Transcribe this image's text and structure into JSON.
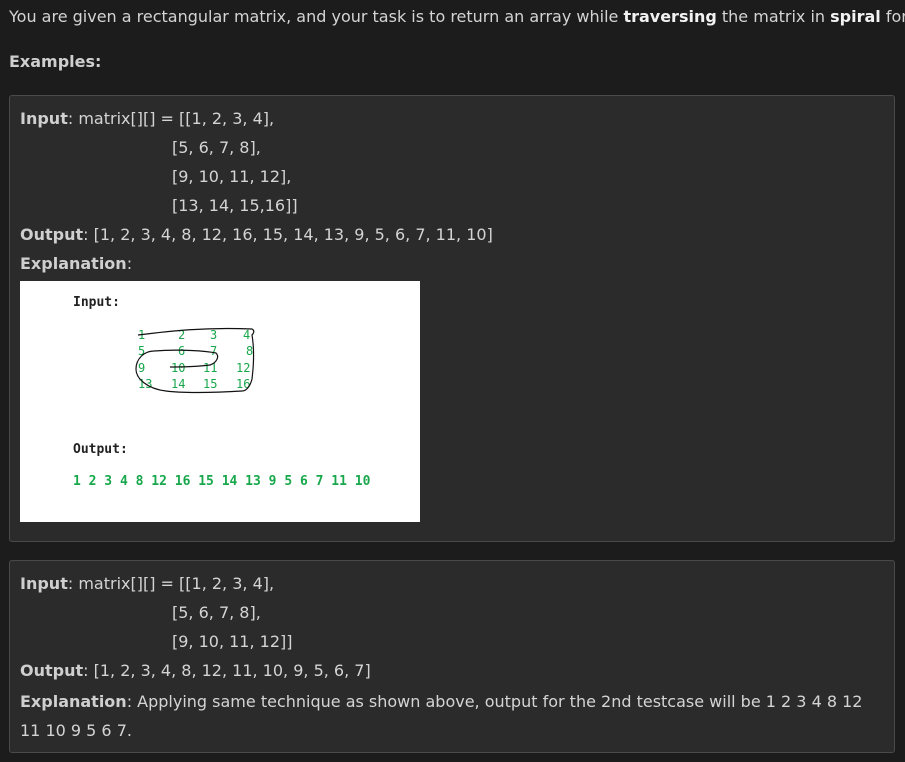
{
  "intro": {
    "p1": "You are given a rectangular matrix, and your task is to return an array while ",
    "b1": "traversing",
    "p2": " the matrix in ",
    "b2": "spiral",
    "p3": " form."
  },
  "examples_heading": "Examples:",
  "example1": {
    "input_label": "Input",
    "input_prefix": ": matrix[][] = ",
    "rows": [
      "[[1, 2, 3, 4],",
      "[5, 6, 7, 8],",
      "[9, 10, 11, 12],",
      "[13, 14, 15,16]]"
    ],
    "output_label": "Output",
    "output_value": ": [1, 2, 3, 4, 8, 12, 16, 15, 14, 13, 9, 5, 6, 7, 11, 10]",
    "explanation_label": "Explanation",
    "explanation_colon": ":",
    "image": {
      "input_title": "Input:",
      "matrix": [
        [
          "1",
          "2",
          "3",
          "4"
        ],
        [
          "5",
          "6",
          "7",
          "8"
        ],
        [
          "9",
          "10",
          "11",
          "12"
        ],
        [
          "13",
          "14",
          "15",
          "16"
        ]
      ],
      "output_title": "Output:",
      "output_sequence": "1 2 3 4 8 12 16 15 14 13 9 5 6 7 11 10"
    }
  },
  "example2": {
    "input_label": "Input",
    "input_prefix": ": matrix[][] = ",
    "rows": [
      "[[1, 2, 3, 4],",
      "[5, 6, 7, 8],",
      "[9, 10, 11, 12]]"
    ],
    "output_label": "Output",
    "output_value": ": [1, 2, 3, 4, 8, 12, 11, 10, 9, 5, 6, 7]",
    "explanation_label": "Explanation",
    "explanation_text": ": Applying same technique as shown above, output for the 2nd testcase will be 1 2 3 4 8 12 11 10 9 5 6 7."
  }
}
